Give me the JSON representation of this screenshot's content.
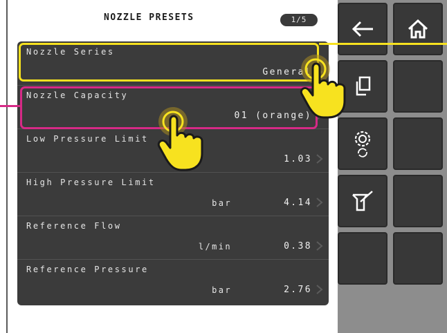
{
  "header": {
    "title": "NOZZLE PRESETS",
    "pager": "1/5"
  },
  "rows": [
    {
      "label": "Nozzle Series",
      "unit": "",
      "value": "General"
    },
    {
      "label": "Nozzle Capacity",
      "unit": "",
      "value": "01 (orange)"
    },
    {
      "label": "Low Pressure Limit",
      "unit": "",
      "value": "1.03"
    },
    {
      "label": "High Pressure Limit",
      "unit": "bar",
      "value": "4.14"
    },
    {
      "label": "Reference Flow",
      "unit": "l/min",
      "value": "0.38"
    },
    {
      "label": "Reference Pressure",
      "unit": "bar",
      "value": "2.76"
    }
  ],
  "sidebar": {
    "buttons": [
      "back-arrow-icon",
      "home-icon",
      "copy-icon",
      "blank",
      "settings-sync-icon",
      "blank",
      "sprayer-calibrate-icon",
      "blank",
      "blank",
      "blank"
    ]
  },
  "colors": {
    "highlight_yellow": "#f7e21f",
    "highlight_magenta": "#d62a86",
    "panel": "#3b3b3b",
    "sidebar": "#8d8d8d"
  }
}
